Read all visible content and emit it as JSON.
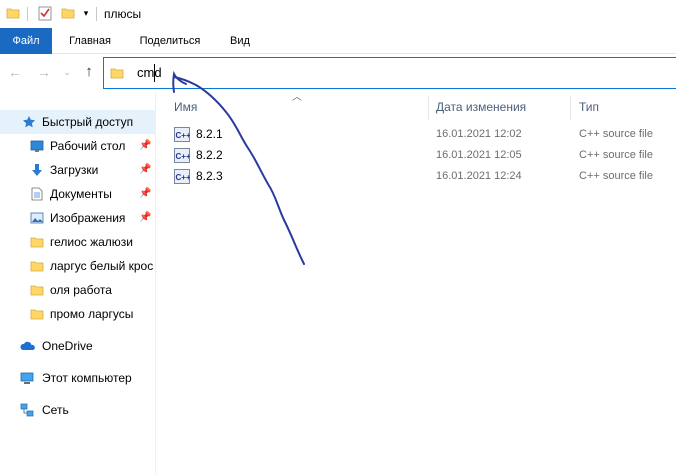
{
  "window": {
    "title": "плюсы"
  },
  "ribbon": {
    "tabs": [
      "Файл",
      "Главная",
      "Поделиться",
      "Вид"
    ]
  },
  "address_bar": {
    "value": "cmd"
  },
  "sidebar": {
    "quick_access": "Быстрый доступ",
    "items": [
      {
        "label": "Рабочий стол",
        "icon": "desktop-icon",
        "pinned": true
      },
      {
        "label": "Загрузки",
        "icon": "downloads-icon",
        "pinned": true
      },
      {
        "label": "Документы",
        "icon": "documents-icon",
        "pinned": true
      },
      {
        "label": "Изображения",
        "icon": "pictures-icon",
        "pinned": true
      },
      {
        "label": "гелиос жалюзи",
        "icon": "folder-icon",
        "pinned": false
      },
      {
        "label": "ларгус белый крос",
        "icon": "folder-icon",
        "pinned": false
      },
      {
        "label": "оля работа",
        "icon": "folder-icon",
        "pinned": false
      },
      {
        "label": "промо ларгусы",
        "icon": "folder-icon",
        "pinned": false
      }
    ],
    "onedrive": "OneDrive",
    "this_pc": "Этот компьютер",
    "network": "Сеть"
  },
  "file_list": {
    "columns": [
      "Имя",
      "Дата изменения",
      "Тип"
    ],
    "rows": [
      {
        "name": "8.2.1",
        "date": "16.01.2021 12:02",
        "type": "C++ source file"
      },
      {
        "name": "8.2.2",
        "date": "16.01.2021 12:05",
        "type": "C++ source file"
      },
      {
        "name": "8.2.3",
        "date": "16.01.2021 12:24",
        "type": "C++ source file"
      }
    ]
  },
  "colors": {
    "file_tab": "#1a6ac3",
    "selection": "#e5f1fb",
    "address_border": "#0a78d7",
    "folder": "#ffd766",
    "annotation": "#2a3a9e"
  }
}
